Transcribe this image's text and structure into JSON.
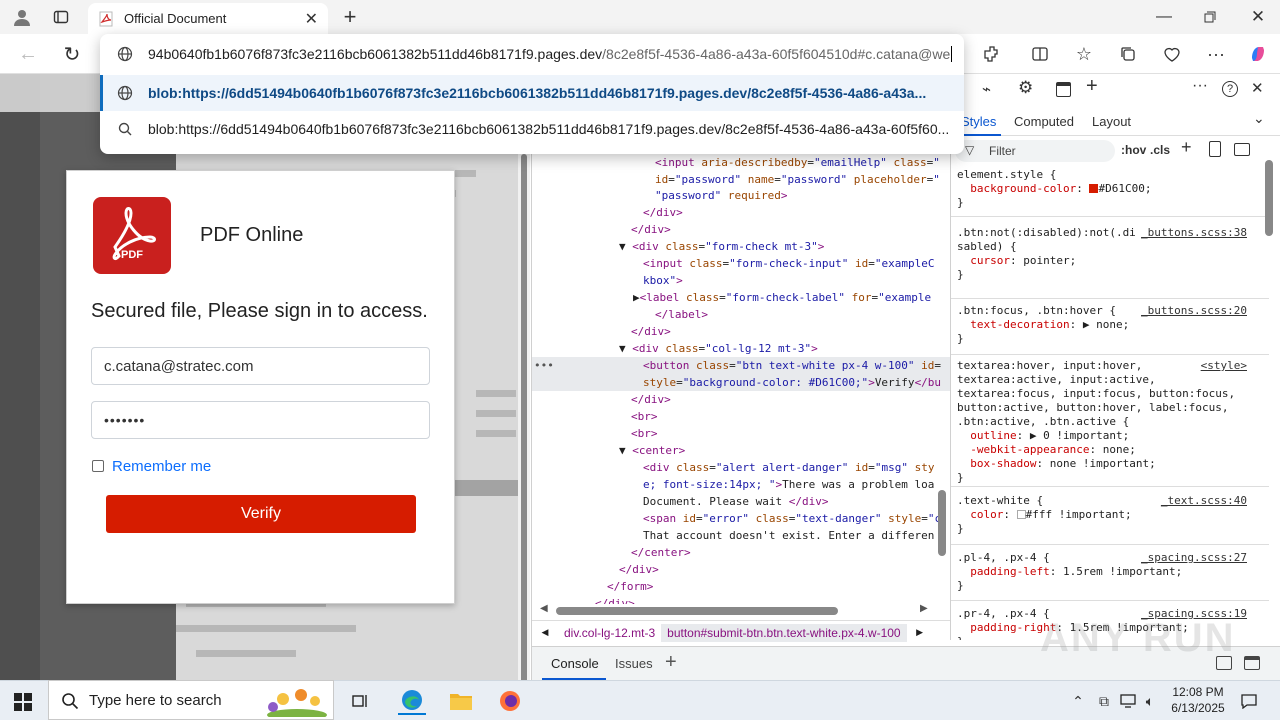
{
  "browser": {
    "tab_title": "Official Document",
    "address_text": "94b0640fb1b6076f873fc3e2116bcb6061382b511dd46b8171f9.pages.dev",
    "address_path": "/8c2e8f5f-4536-4a86-a43a-60f5f604510d#c.catana@we",
    "suggestions": [
      "blob:https://6dd51494b0640fb1b6076f873fc3e2116bcb6061382b511dd46b8171f9.pages.dev/8c2e8f5f-4536-4a86-a43a...",
      "blob:https://6dd51494b0640fb1b6076f873fc3e2116bcb6061382b511dd46b8171f9.pages.dev/8c2e8f5f-4536-4a86-a43a-60f5f60..."
    ]
  },
  "login": {
    "brand": "PDF Online",
    "logo_text": "PDF",
    "heading": "Secured file, Please sign in to access.",
    "email_value": "c.catana@stratec.com",
    "password_mask": "•••••••",
    "remember_label": "Remember me",
    "verify_label": "Verify"
  },
  "devtools": {
    "tabs": {
      "styles": "Styles",
      "computed": "Computed",
      "layout": "Layout"
    },
    "filter_placeholder": "Filter",
    "hov": ":hov",
    "cls": ".cls",
    "breadcrumb_1": "div.col-lg-12.mt-3",
    "breadcrumb_2": "button#submit-btn.btn.text-white.px-4.w-100",
    "drawer_console": "Console",
    "drawer_issues": "Issues",
    "accent": "#D61C00"
  },
  "taskbar": {
    "search_placeholder": "Type here to search",
    "time": "12:08 PM",
    "date": "6/13/2025"
  },
  "watermark": "ANY RUN"
}
